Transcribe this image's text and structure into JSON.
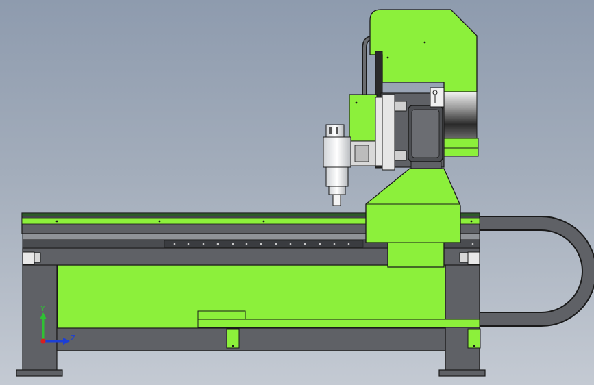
{
  "viewport": {
    "background_top": "#8e9bae",
    "background_bottom": "#c4cad3"
  },
  "model": {
    "accent_green": "#8cf03b",
    "frame_gray": "#5f6166",
    "dark_line": "#1a1a1a"
  },
  "triad": {
    "y_label": "Y",
    "z_label": "Z",
    "y_color": "#2fc233",
    "z_color": "#1c3fd6",
    "x_color": "#d81f1f"
  }
}
